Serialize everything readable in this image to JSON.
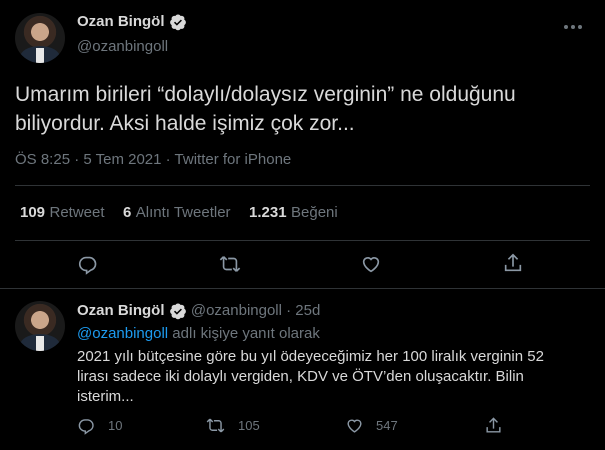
{
  "main_tweet": {
    "author_name": "Ozan Bingöl",
    "author_handle": "@ozanbingoll",
    "text_line1": "Umarım birileri “dolaylı/dolaysız verginin” ne olduğunu",
    "text_line2": "biliyordur. Aksi halde işimiz çok zor...",
    "meta": "ÖS 8:25 · 5 Tem 2021 · Twitter for iPhone",
    "retweets_count": "109",
    "retweets_label": "Retweet",
    "quotes_count": "6",
    "quotes_label": "Alıntı Tweetler",
    "likes_count": "1.231",
    "likes_label": "Beğeni"
  },
  "reply_tweet": {
    "author_name": "Ozan Bingöl",
    "author_handle": "@ozanbingoll",
    "time": "· 25d",
    "replying_to_handle": "@ozanbingoll",
    "replying_to_suffix": "adlı kişiye yanıt olarak",
    "text_line1": "2021 yılı bütçesine göre bu yıl  ödeyeceğimiz her 100 liralık verginin 52",
    "text_line2": "lirası sadece iki dolaylı vergiden, KDV ve ÖTV’den oluşacaktır. Bilin",
    "text_line3": "isterim...",
    "reply_count": "10",
    "retweet_count": "105",
    "like_count": "547"
  },
  "colors": {
    "background": "#000000",
    "text": "#d9d9d9",
    "secondary": "#6e767d",
    "accent": "#1d9bf0",
    "divider": "#2f3336"
  },
  "icons": [
    "verified-badge-icon",
    "more-icon",
    "reply-icon",
    "retweet-icon",
    "like-icon",
    "share-icon"
  ]
}
